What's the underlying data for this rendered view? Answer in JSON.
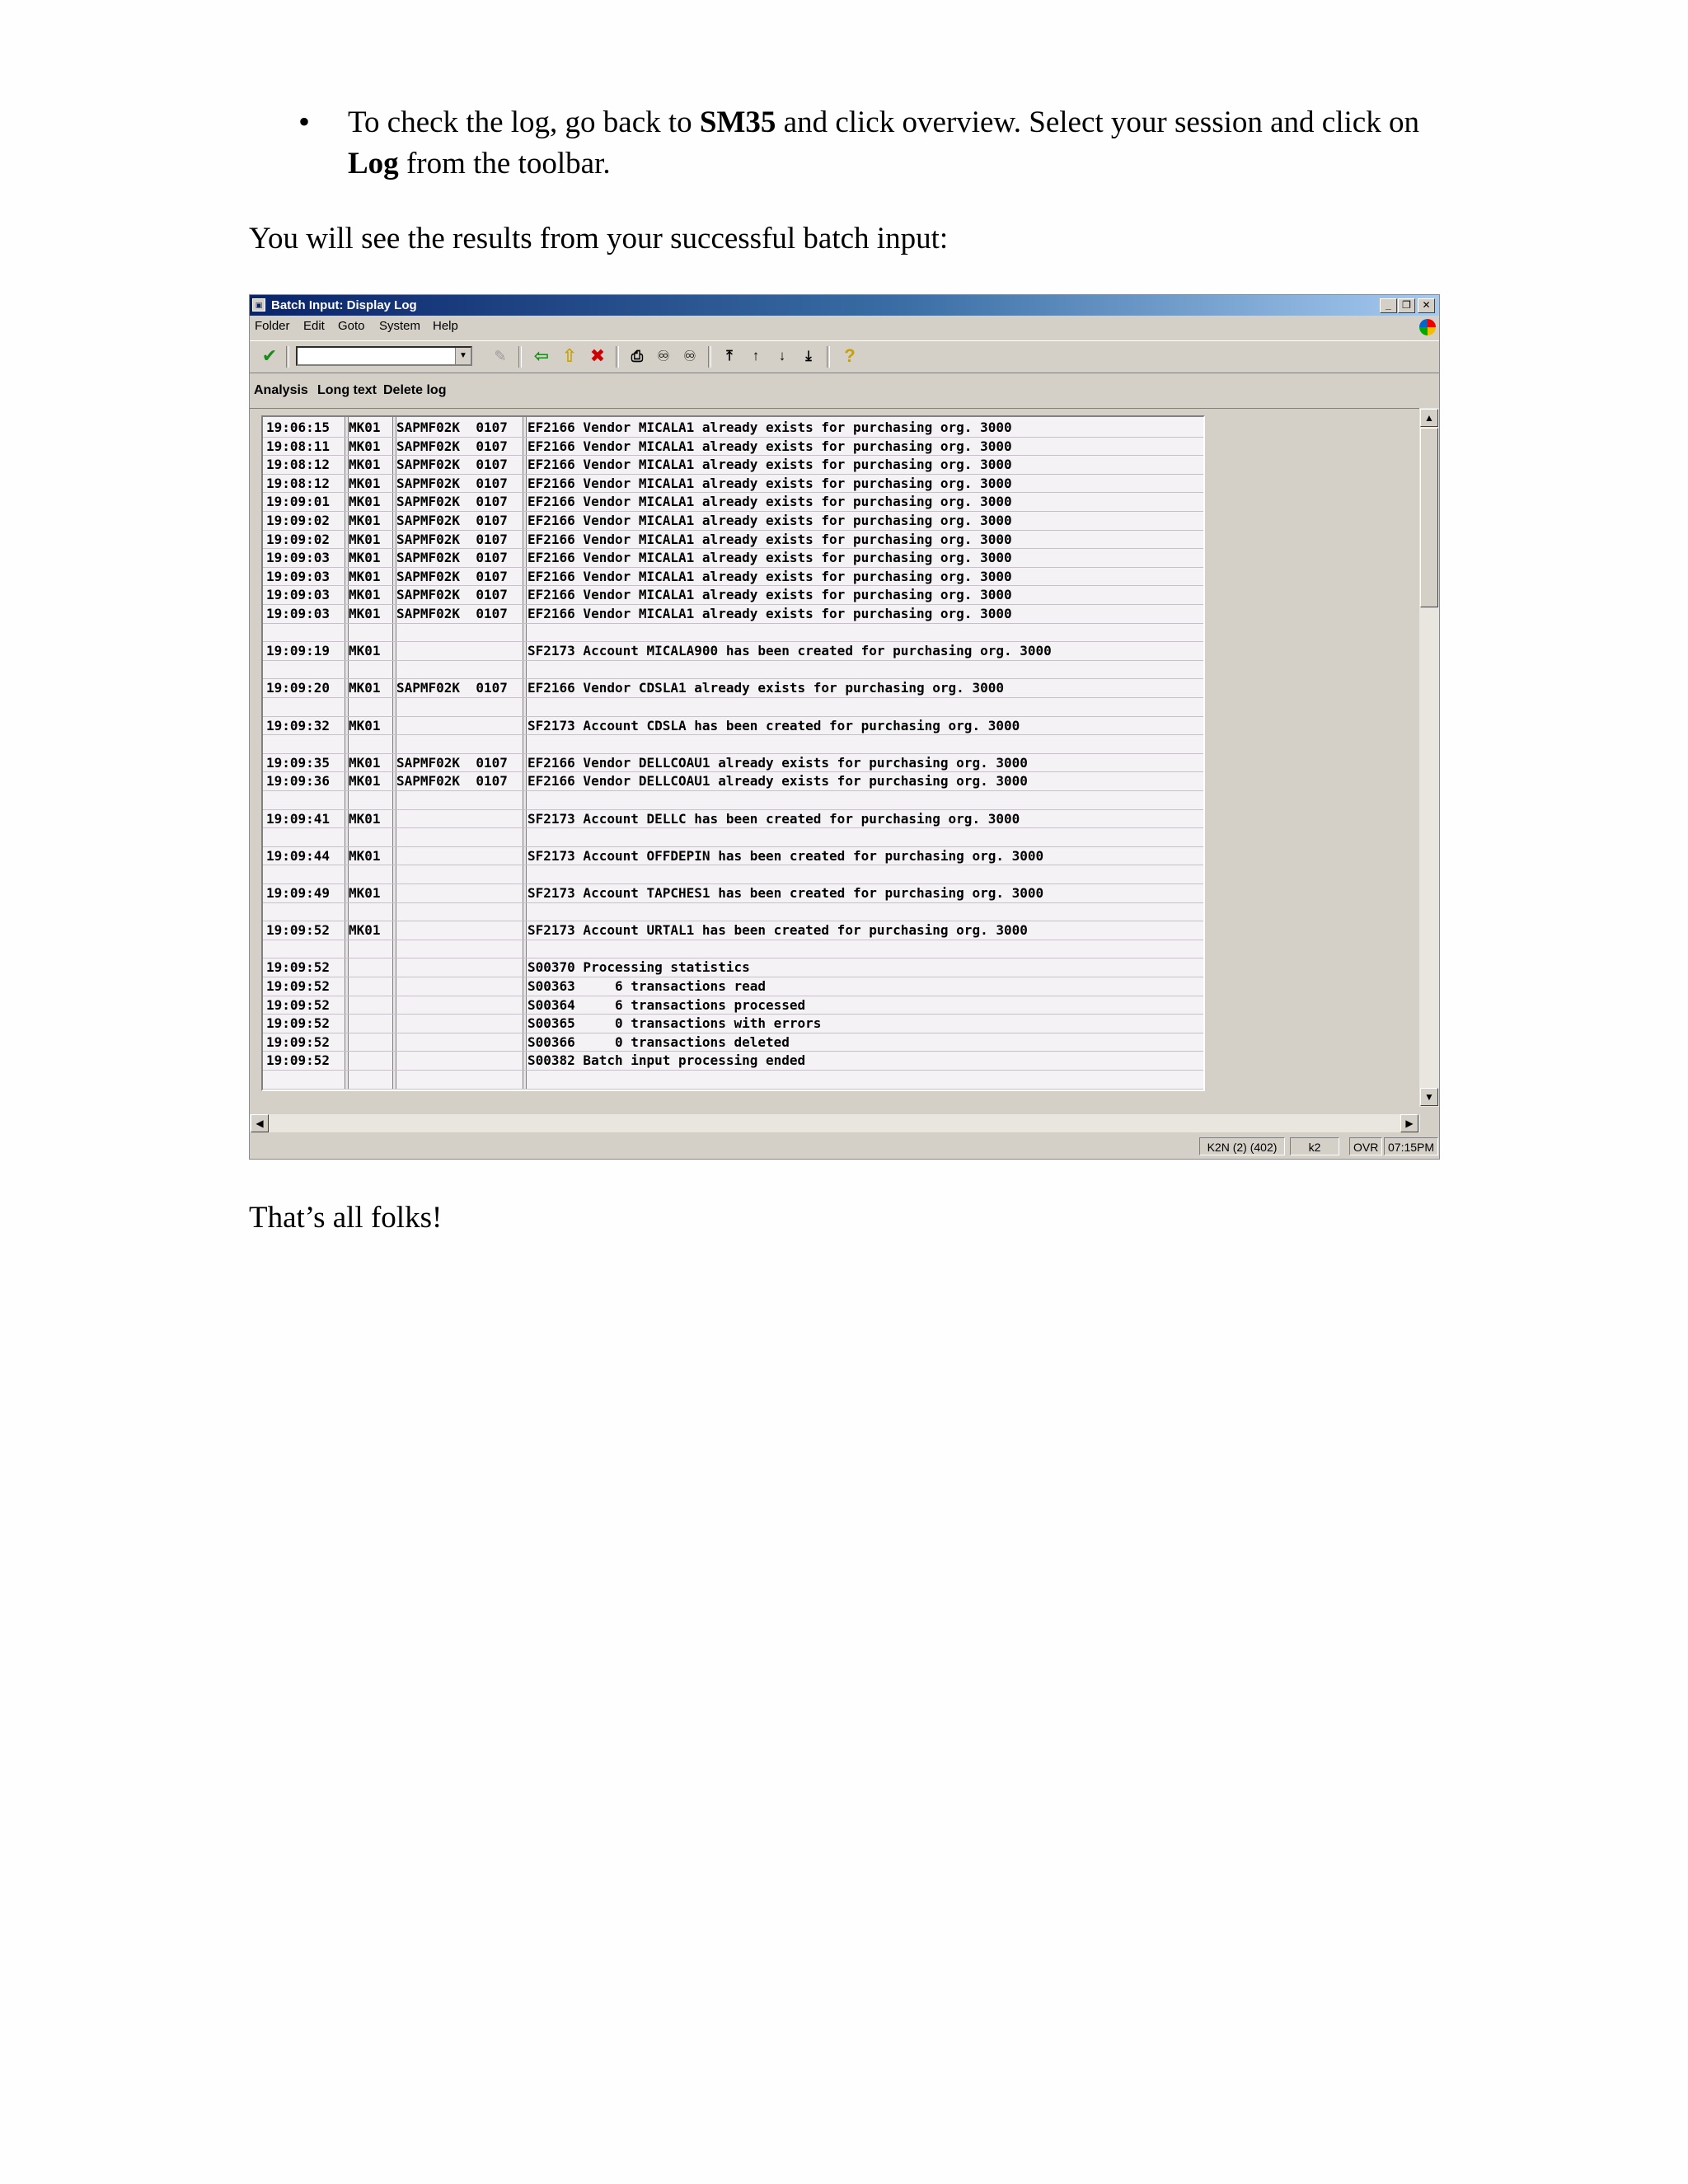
{
  "document": {
    "bullet_text": [
      "To check the log, go back to ",
      "SM35",
      " and click overview.  Select your session and click on ",
      "Log",
      " from the toolbar."
    ],
    "intro": "You will see the results from your successful batch input:",
    "outro": "That’s all folks!"
  },
  "window": {
    "title": "Batch Input: Display Log",
    "menu": [
      "Folder",
      "Edit",
      "Goto",
      "System",
      "Help"
    ],
    "app_toolbar": [
      "Analysis",
      "Long text",
      "Delete log"
    ],
    "toolbar_icons": [
      "checkmark-icon",
      "save-icon",
      "back-icon",
      "exit-icon",
      "cancel-icon",
      "print-icon",
      "find-icon",
      "find-next-icon",
      "first-page-icon",
      "previous-page-icon",
      "next-page-icon",
      "last-page-icon",
      "help-icon"
    ],
    "status": {
      "system": "K2N (2) (402)",
      "server": "k2",
      "mode": "OVR",
      "time": "07:15PM"
    }
  },
  "log_rows": [
    [
      "19:06:15",
      "MK01",
      "SAPMF02K  0107",
      "EF2166 Vendor MICALA1 already exists for purchasing org. 3000"
    ],
    [
      "19:08:11",
      "MK01",
      "SAPMF02K  0107",
      "EF2166 Vendor MICALA1 already exists for purchasing org. 3000"
    ],
    [
      "19:08:12",
      "MK01",
      "SAPMF02K  0107",
      "EF2166 Vendor MICALA1 already exists for purchasing org. 3000"
    ],
    [
      "19:08:12",
      "MK01",
      "SAPMF02K  0107",
      "EF2166 Vendor MICALA1 already exists for purchasing org. 3000"
    ],
    [
      "19:09:01",
      "MK01",
      "SAPMF02K  0107",
      "EF2166 Vendor MICALA1 already exists for purchasing org. 3000"
    ],
    [
      "19:09:02",
      "MK01",
      "SAPMF02K  0107",
      "EF2166 Vendor MICALA1 already exists for purchasing org. 3000"
    ],
    [
      "19:09:02",
      "MK01",
      "SAPMF02K  0107",
      "EF2166 Vendor MICALA1 already exists for purchasing org. 3000"
    ],
    [
      "19:09:03",
      "MK01",
      "SAPMF02K  0107",
      "EF2166 Vendor MICALA1 already exists for purchasing org. 3000"
    ],
    [
      "19:09:03",
      "MK01",
      "SAPMF02K  0107",
      "EF2166 Vendor MICALA1 already exists for purchasing org. 3000"
    ],
    [
      "19:09:03",
      "MK01",
      "SAPMF02K  0107",
      "EF2166 Vendor MICALA1 already exists for purchasing org. 3000"
    ],
    [
      "19:09:03",
      "MK01",
      "SAPMF02K  0107",
      "EF2166 Vendor MICALA1 already exists for purchasing org. 3000"
    ],
    [
      "",
      "",
      "",
      ""
    ],
    [
      "19:09:19",
      "MK01",
      "",
      "SF2173 Account MICALA900 has been created for purchasing org. 3000"
    ],
    [
      "",
      "",
      "",
      ""
    ],
    [
      "19:09:20",
      "MK01",
      "SAPMF02K  0107",
      "EF2166 Vendor CDSLA1 already exists for purchasing org. 3000"
    ],
    [
      "",
      "",
      "",
      ""
    ],
    [
      "19:09:32",
      "MK01",
      "",
      "SF2173 Account CDSLA has been created for purchasing org. 3000"
    ],
    [
      "",
      "",
      "",
      ""
    ],
    [
      "19:09:35",
      "MK01",
      "SAPMF02K  0107",
      "EF2166 Vendor DELLCOAU1 already exists for purchasing org. 3000"
    ],
    [
      "19:09:36",
      "MK01",
      "SAPMF02K  0107",
      "EF2166 Vendor DELLCOAU1 already exists for purchasing org. 3000"
    ],
    [
      "",
      "",
      "",
      ""
    ],
    [
      "19:09:41",
      "MK01",
      "",
      "SF2173 Account DELLC has been created for purchasing org. 3000"
    ],
    [
      "",
      "",
      "",
      ""
    ],
    [
      "19:09:44",
      "MK01",
      "",
      "SF2173 Account OFFDEPIN has been created for purchasing org. 3000"
    ],
    [
      "",
      "",
      "",
      ""
    ],
    [
      "19:09:49",
      "MK01",
      "",
      "SF2173 Account TAPCHES1 has been created for purchasing org. 3000"
    ],
    [
      "",
      "",
      "",
      ""
    ],
    [
      "19:09:52",
      "MK01",
      "",
      "SF2173 Account URTAL1 has been created for purchasing org. 3000"
    ],
    [
      "",
      "",
      "",
      ""
    ],
    [
      "19:09:52",
      "",
      "",
      "S00370 Processing statistics"
    ],
    [
      "19:09:52",
      "",
      "",
      "S00363     6 transactions read"
    ],
    [
      "19:09:52",
      "",
      "",
      "S00364     6 transactions processed"
    ],
    [
      "19:09:52",
      "",
      "",
      "S00365     0 transactions with errors"
    ],
    [
      "19:09:52",
      "",
      "",
      "S00366     0 transactions deleted"
    ],
    [
      "19:09:52",
      "",
      "",
      "S00382 Batch input processing ended"
    ],
    [
      "",
      "",
      "",
      ""
    ]
  ]
}
